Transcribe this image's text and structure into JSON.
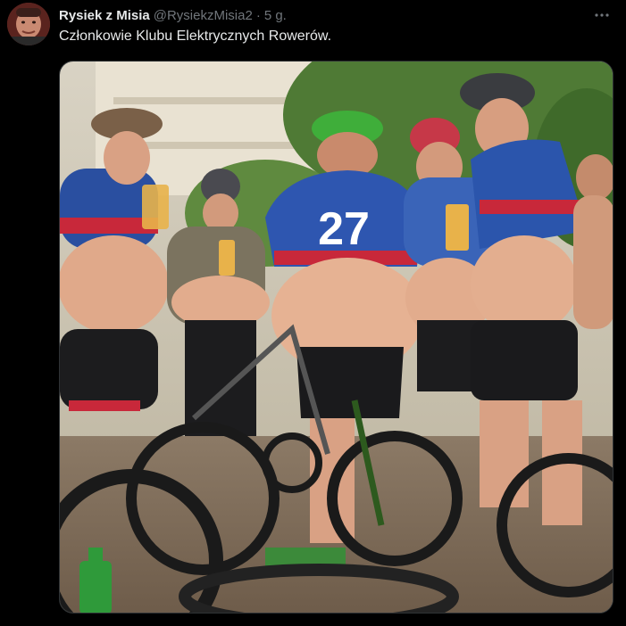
{
  "tweet": {
    "author": {
      "display_name": "Rysiek z Misia",
      "handle": "@RysiekzMisia2",
      "separator": "·",
      "time": "5 g."
    },
    "text": "Członkowie Klubu Elektrycznych Rowerów.",
    "more_icon": "more-horizontal-icon",
    "media": {
      "jersey_number": "27"
    }
  },
  "colors": {
    "background": "#000000",
    "text_primary": "#e7e9ea",
    "text_secondary": "#71767b",
    "border": "#2f3336"
  }
}
